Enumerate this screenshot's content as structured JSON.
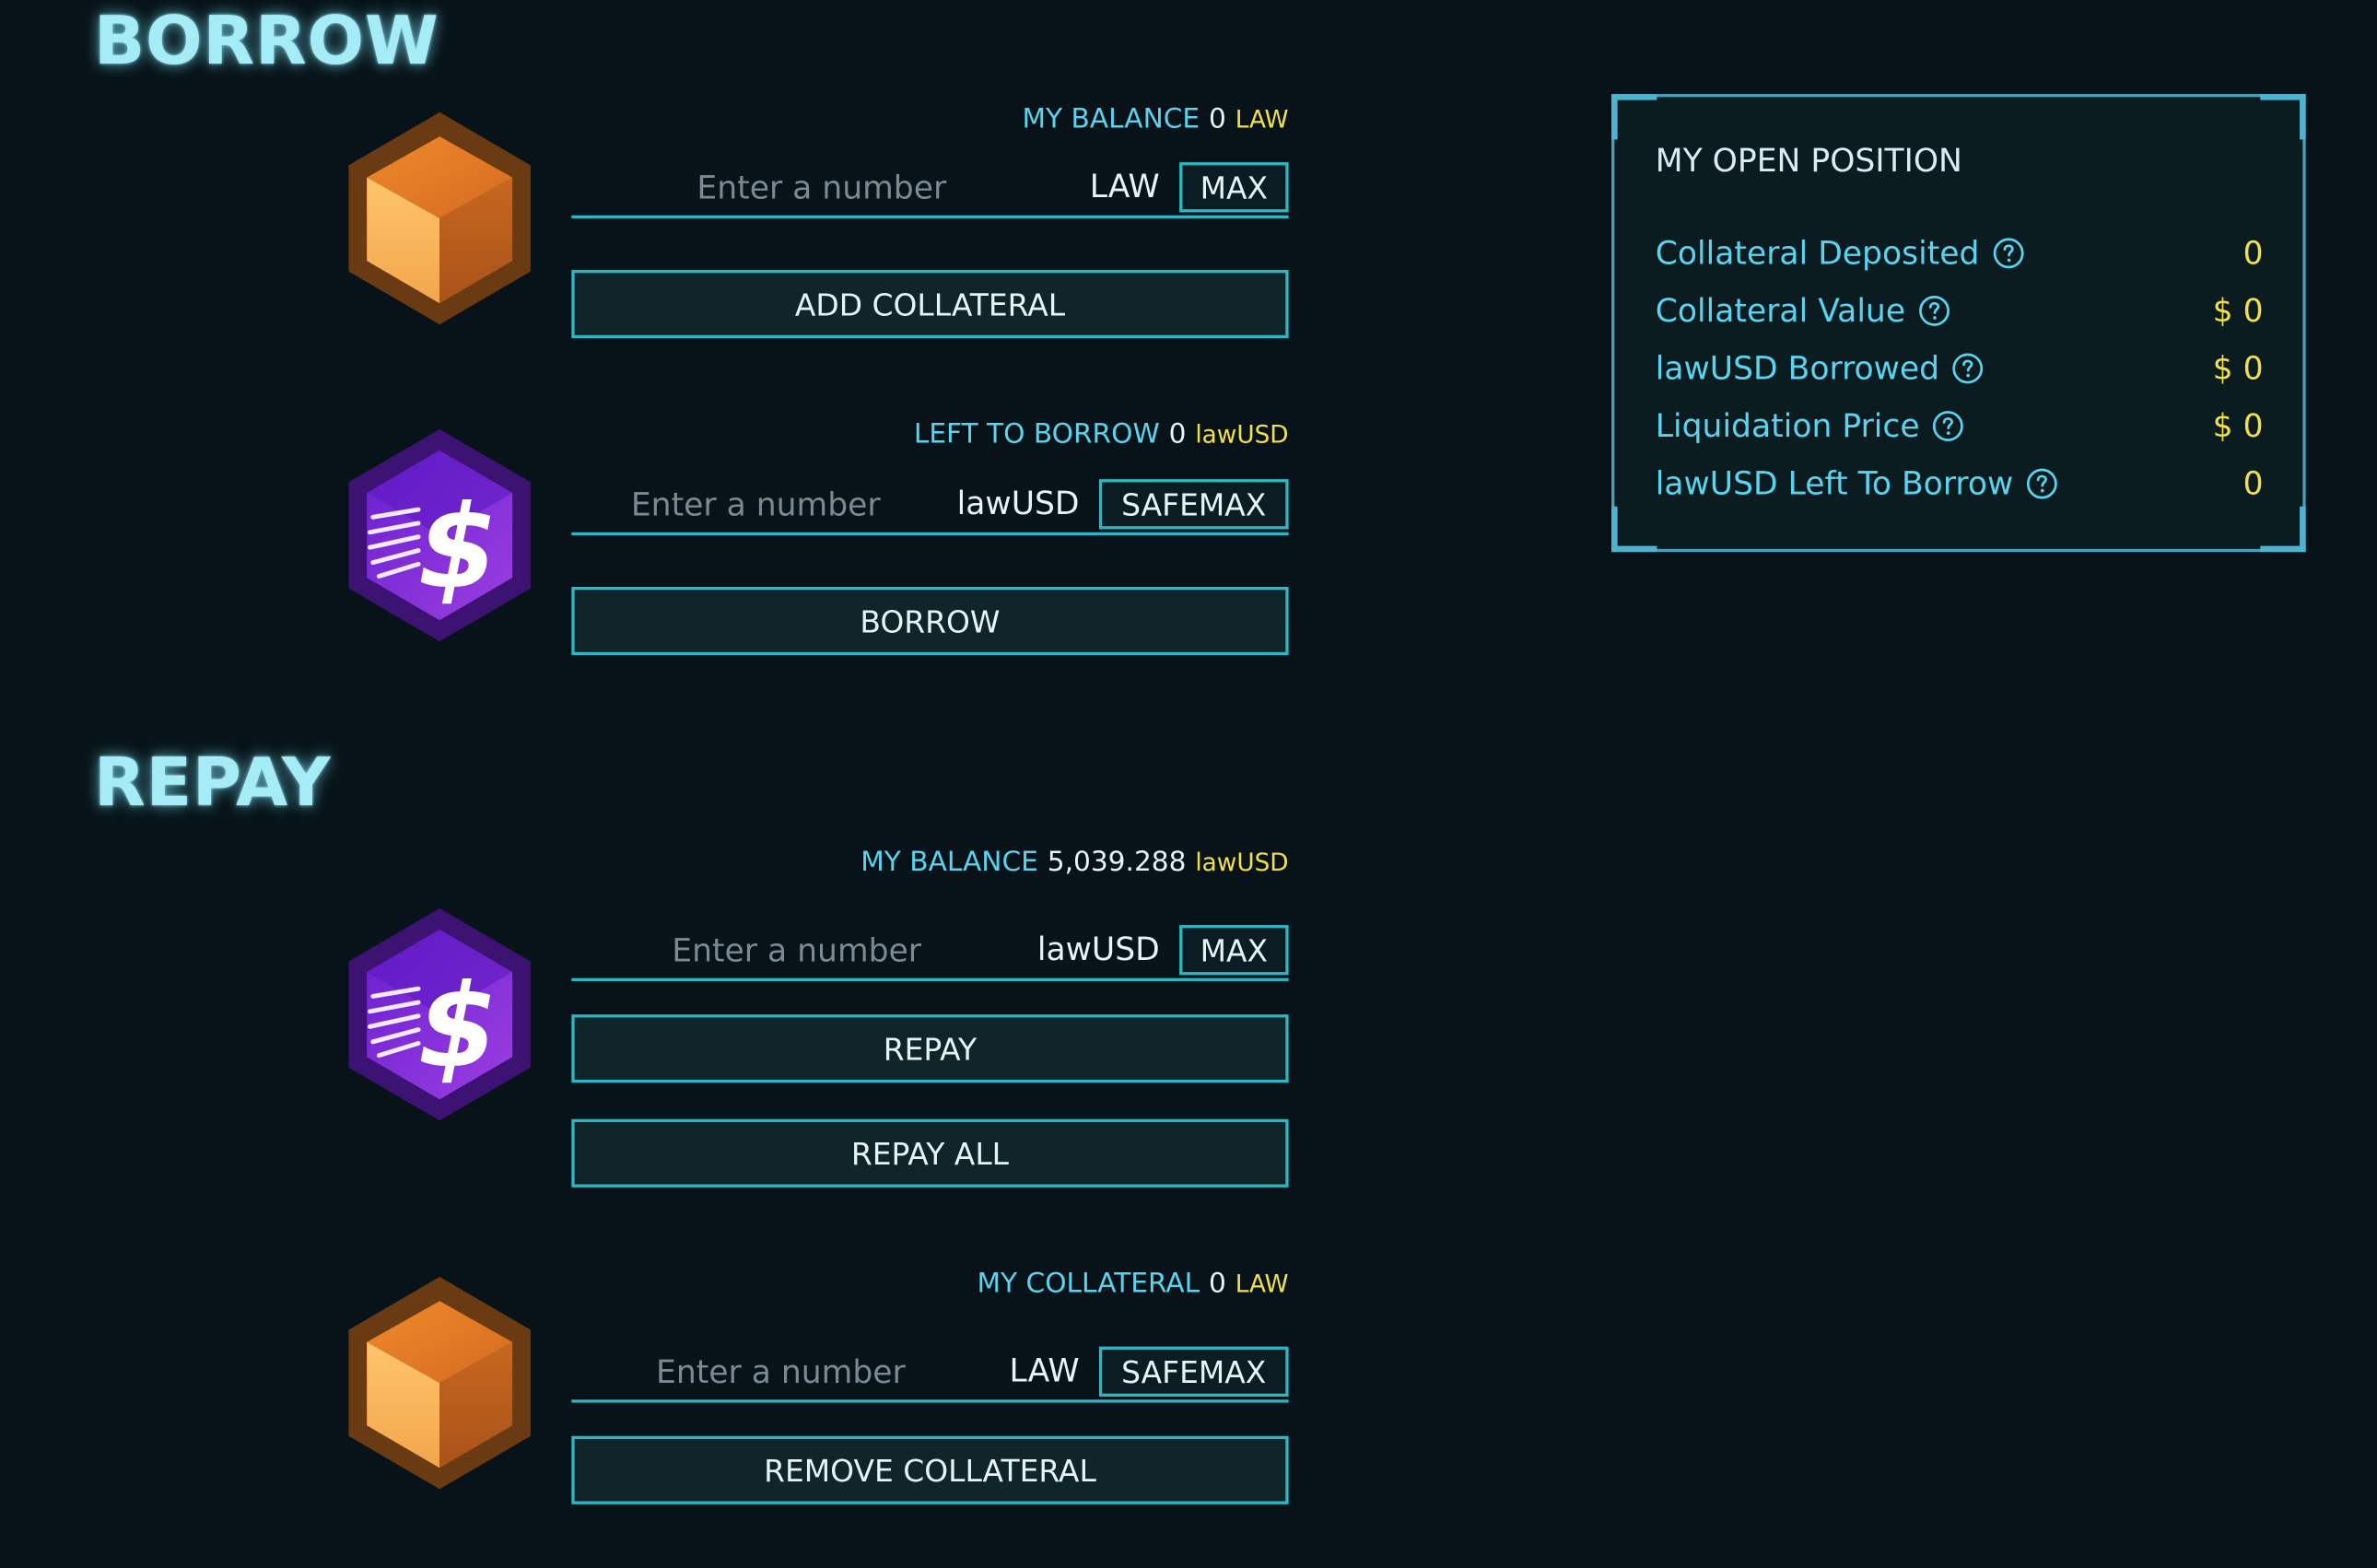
{
  "borrow": {
    "title": "BORROW",
    "collateral": {
      "icon": "law-token-icon",
      "balance_label": "MY BALANCE",
      "balance_value": "0",
      "balance_unit": "LAW",
      "input_placeholder": "Enter a number",
      "unit": "LAW",
      "max_label": "MAX",
      "action_label": "ADD COLLATERAL"
    },
    "loan": {
      "icon": "lawusd-token-icon",
      "balance_label": "LEFT TO BORROW",
      "balance_value": "0",
      "balance_unit": "lawUSD",
      "input_placeholder": "Enter a number",
      "unit": "lawUSD",
      "max_label": "SAFEMAX",
      "action_label": "BORROW"
    }
  },
  "repay": {
    "title": "REPAY",
    "debt": {
      "icon": "lawusd-token-icon",
      "balance_label": "MY BALANCE",
      "balance_value": "5,039.288",
      "balance_unit": "lawUSD",
      "input_placeholder": "Enter a number",
      "unit": "lawUSD",
      "max_label": "MAX",
      "action_label": "REPAY",
      "secondary_action_label": "REPAY ALL"
    },
    "withdraw": {
      "icon": "law-token-icon",
      "balance_label": "MY COLLATERAL",
      "balance_value": "0",
      "balance_unit": "LAW",
      "input_placeholder": "Enter a number",
      "unit": "LAW",
      "max_label": "SAFEMAX",
      "action_label": "REMOVE COLLATERAL"
    }
  },
  "position": {
    "title": "MY OPEN POSITION",
    "rows": [
      {
        "label": "Collateral Deposited",
        "value": "0"
      },
      {
        "label": "Collateral Value",
        "value": "$ 0"
      },
      {
        "label": "lawUSD Borrowed",
        "value": "$ 0"
      },
      {
        "label": "Liquidation Price",
        "value": "$ 0"
      },
      {
        "label": "lawUSD Left To Borrow",
        "value": "0"
      }
    ]
  },
  "colors": {
    "background": "#071318",
    "accent": "#2bb8c4",
    "label": "#5ad4ee",
    "value": "#f2e04b",
    "title_glow": "#a5ecf6"
  }
}
